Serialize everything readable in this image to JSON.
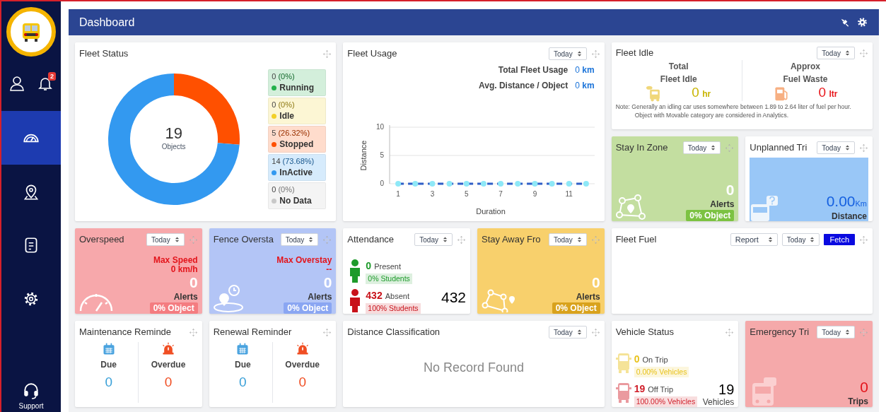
{
  "sidebar": {
    "notifications": "2",
    "nav_items": [
      {
        "selected": true
      },
      {
        "selected": false
      },
      {
        "selected": false
      },
      {
        "selected": false
      },
      {
        "selected": false,
        "label": "Support"
      }
    ]
  },
  "header": {
    "title": "Dashboard"
  },
  "widgets": [
    {
      "kind": "fleet_status",
      "title": "Fleet Status",
      "total": "19",
      "total_label": "Objects",
      "legend": [
        {
          "count": "0",
          "percent": "(0%)",
          "label": "Running",
          "color": "#22b14c"
        },
        {
          "count": "0",
          "percent": "(0%)",
          "label": "Idle",
          "color": "#f2d027"
        },
        {
          "count": "5",
          "percent": "(26.32%)",
          "label": "Stopped",
          "color": "#ff5000"
        },
        {
          "count": "14",
          "percent": "(73.68%)",
          "label": "InActive",
          "color": "#3399f0"
        },
        {
          "count": "0",
          "percent": "(0%)",
          "label": "No Data",
          "color": "#c8c8c8"
        }
      ],
      "chart_data": {
        "type": "donut",
        "values": [
          0,
          0,
          26.32,
          73.68,
          0
        ]
      }
    },
    {
      "kind": "fleet_usage",
      "title": "Fleet Usage",
      "period": "Today",
      "stats": [
        {
          "label": "Total Fleet Usage",
          "value": "0",
          "unit": "km"
        },
        {
          "label": "Avg. Distance / Object",
          "value": "0",
          "unit": "km"
        }
      ],
      "chart_data": {
        "type": "line",
        "xlabel": "Duration",
        "ylabel": "Distance",
        "x": [
          1,
          2,
          3,
          4,
          5,
          6,
          7,
          8,
          9,
          10,
          11,
          12
        ],
        "series": [
          {
            "color": "#2f5fc8",
            "line_style": "dashed",
            "marker": "circle",
            "values": [
              0,
              0,
              0,
              0,
              0,
              0,
              0,
              0,
              0,
              0,
              0,
              0
            ]
          }
        ],
        "xlim": [
          0.5,
          12.5
        ],
        "ylim": [
          0,
          10
        ],
        "xticks": [
          1,
          3,
          5,
          7,
          9,
          11
        ],
        "yticks": [
          0,
          5,
          10
        ]
      }
    },
    {
      "kind": "fleet_idle",
      "title": "Fleet Idle",
      "period": "Today",
      "metrics": [
        {
          "kind": "idle",
          "title_lines": [
            "Total",
            "Fleet Idle"
          ],
          "value": "0",
          "unit": "hr",
          "color": "#c8b400"
        },
        {
          "kind": "fuel",
          "title_lines": [
            "Approx",
            "Fuel Waste"
          ],
          "value": "0",
          "unit": "ltr",
          "color": "#e8161b"
        }
      ],
      "note": "Note:  Generally an idling car uses somewhere between 1.89 to 2.64 liter of fuel per hour. Object with Movable category are considered in Analytics."
    },
    {
      "kind": "stay_zone",
      "title": "Stay In Zone",
      "period": "Today",
      "color": "#c3dea0",
      "count": "0",
      "count_label": "Alerts",
      "badge": "0% Object"
    },
    {
      "kind": "unplanned_trip",
      "title": "Unplanned Tri",
      "period": "Today",
      "value": "0.00",
      "unit": "Km",
      "value_label": "Distance"
    },
    {
      "kind": "overspeed",
      "title": "Overspeed",
      "period": "Today",
      "color": "#f7a8ab",
      "headline": [
        "Max Speed",
        "0 km/h"
      ],
      "count": "0",
      "count_label": "Alerts",
      "badge": "0% Object"
    },
    {
      "kind": "fence",
      "title": "Fence Oversta",
      "period": "Today",
      "color": "#b3c5f6",
      "headline": [
        "Max Overstay",
        "--"
      ],
      "count": "0",
      "count_label": "Alerts",
      "badge": "0% Object"
    },
    {
      "kind": "attendance",
      "title": "Attendance",
      "period": "Today",
      "rows": [
        {
          "count": "0",
          "label": "Present",
          "percent": "0% Students",
          "color": "#1d9a2a"
        },
        {
          "count": "432",
          "label": "Absent",
          "percent": "100% Students",
          "color": "#c8121a"
        }
      ],
      "total": "432"
    },
    {
      "kind": "stay_away",
      "title": "Stay Away Fro",
      "period": "Today",
      "color": "#f8d06c",
      "count": "0",
      "count_label": "Alerts",
      "badge": "0% Object"
    },
    {
      "kind": "fleet_fuel",
      "title": "Fleet Fuel",
      "selects": [
        "Report",
        "Today"
      ],
      "button": "Fetch"
    },
    {
      "kind": "reminder",
      "title": "Maintenance Reminde",
      "items": [
        {
          "kind": "due",
          "label": "Due",
          "value": "0"
        },
        {
          "kind": "overdue",
          "label": "Overdue",
          "value": "0"
        }
      ]
    },
    {
      "kind": "reminder",
      "title": "Renewal Reminder",
      "items": [
        {
          "kind": "due",
          "label": "Due",
          "value": "0"
        },
        {
          "kind": "overdue",
          "label": "Overdue",
          "value": "0"
        }
      ]
    },
    {
      "kind": "no_data",
      "title": "Distance Classification",
      "period": "Today",
      "message": "No Record Found"
    },
    {
      "kind": "vehicle_status",
      "title": "Vehicle Status",
      "rows": [
        {
          "count": "0",
          "label": "On Trip",
          "percent": "0.00% Vehicles",
          "color": "#e8c21a"
        },
        {
          "count": "19",
          "label": "Off Trip",
          "percent": "100.00% Vehicles",
          "color": "#d01f2a"
        }
      ],
      "total": "19",
      "total_label": "Vehicles"
    },
    {
      "kind": "emergency_trip",
      "title": "Emergency Tri",
      "period": "Today",
      "color": "#f5a9aa",
      "value": "0",
      "value_label": "Trips"
    }
  ]
}
